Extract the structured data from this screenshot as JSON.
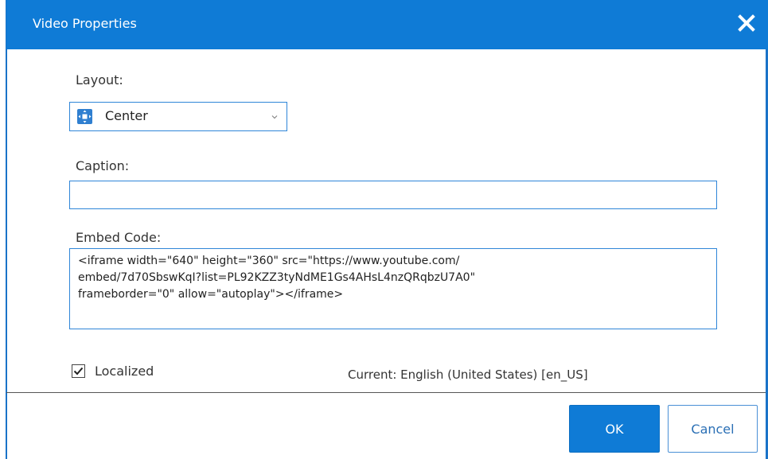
{
  "dialog": {
    "title": "Video Properties",
    "close_icon": "close-icon"
  },
  "layout": {
    "label": "Layout:",
    "value": "Center",
    "icon": "layout-center-icon"
  },
  "caption": {
    "label": "Caption:",
    "value": ""
  },
  "embed": {
    "label": "Embed Code:",
    "value": "<iframe width=\"640\" height=\"360\" src=\"https://www.youtube.com/\nembed/7d70SbswKqI?list=PL92KZZ3tyNdME1Gs4AHsL4nzQRqbzU7A0\"\nframeborder=\"0\" allow=\"autoplay\"></iframe>"
  },
  "localized": {
    "label": "Localized",
    "checked": true
  },
  "current_locale": "Current: English (United States) [en_US]",
  "buttons": {
    "ok": "OK",
    "cancel": "Cancel"
  },
  "colors": {
    "accent": "#0f7bd6",
    "field_border": "#2f86d8"
  }
}
